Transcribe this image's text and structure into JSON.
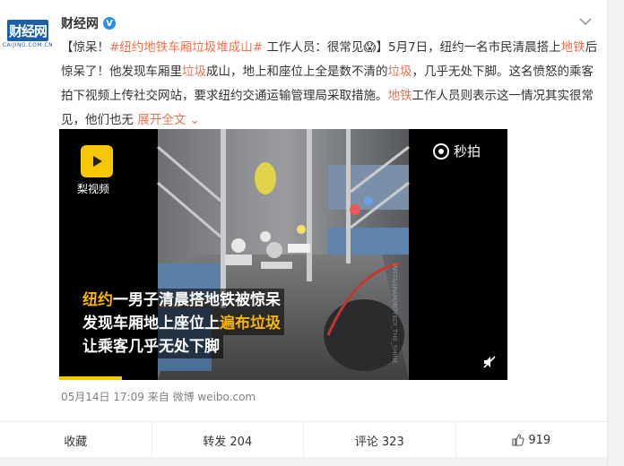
{
  "post": {
    "author": "财经网",
    "avatar_logo": "财经网",
    "avatar_sub": "CAIJING.COM.CN",
    "text_segments": [
      {
        "t": "【惊呆！",
        "link": false
      },
      {
        "t": "#纽约地铁车厢垃圾堆成山#",
        "link": true
      },
      {
        "t": " 工作人员：很常见",
        "link": false
      },
      {
        "t": "😱",
        "link": false
      },
      {
        "t": "】5月7日，纽约一名市民清晨搭上",
        "link": false
      },
      {
        "t": "地铁",
        "link": true
      },
      {
        "t": "后惊呆了！他发现车厢里",
        "link": false
      },
      {
        "t": "垃圾",
        "link": true
      },
      {
        "t": "成山，地上和座位上全是数不清的",
        "link": false
      },
      {
        "t": "垃圾",
        "link": true
      },
      {
        "t": "，几乎无处下脚。这名愤怒的乘客拍下视频上传社交网站，要求纽约交通运输管理局采取措施。",
        "link": false
      },
      {
        "t": "地铁",
        "link": true
      },
      {
        "t": "工作人员则表示这一情况其实很常见，他们也无 ",
        "link": false
      }
    ],
    "more_label": "展开全文",
    "more_icon": "chevron-down-icon",
    "meta": "05月14日 17:09 来自 微博 weibo.com"
  },
  "video": {
    "brand_left": "梨视频",
    "brand_right": "秒拍",
    "caption_lines": [
      [
        {
          "t": "纽约",
          "hl": true
        },
        {
          "t": "一男子清晨搭地铁被惊呆",
          "hl": false
        }
      ],
      [
        {
          "t": "发现车厢地上座位上",
          "hl": false
        },
        {
          "t": "遍布垃圾",
          "hl": true
        }
      ],
      [
        {
          "t": "让乘客几乎无处下脚",
          "hl": false
        }
      ]
    ],
    "watermark": "INSTAGRAM/BOYBOI_THE_SHINE"
  },
  "actions": {
    "favorite": "收藏",
    "repost": "转发 204",
    "comment": "评论 323",
    "like": "919"
  },
  "colors": {
    "link": "#eb7350",
    "verified": "#2a8ee8",
    "brand": "#1a5fa8",
    "highlight": "#f7b500"
  }
}
